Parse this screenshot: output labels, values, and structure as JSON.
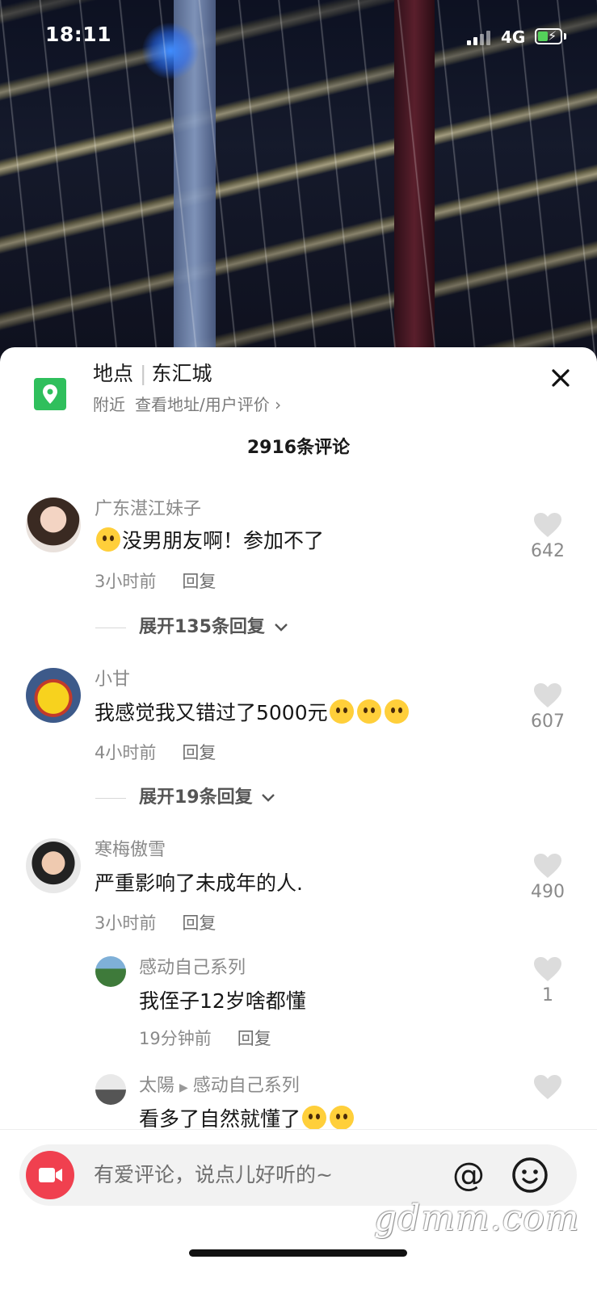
{
  "status_bar": {
    "time": "18:11",
    "network": "4G"
  },
  "location": {
    "label": "地点",
    "name": "东汇城",
    "sub_nearby": "附近",
    "sub_link": "查看地址/用户评价",
    "sub_chevron": "›"
  },
  "close_label": "✕",
  "comment_count": "2916条评论",
  "comments": [
    {
      "name": "广东湛江妹子",
      "text": "没男朋友啊！参加不了",
      "time": "3小时前",
      "reply": "回复",
      "likes": "642",
      "expand": "展开135条回复",
      "emoji": "laughing-tears-emoji"
    },
    {
      "name": "小甘",
      "text": "我感觉我又错过了5000元",
      "time": "4小时前",
      "reply": "回复",
      "likes": "607",
      "expand": "展开19条回复",
      "emoji": "pleading-face-emoji"
    },
    {
      "name": "寒梅傲雪",
      "text": "严重影响了未成年的人.",
      "time": "3小时前",
      "reply": "回复",
      "likes": "490"
    }
  ],
  "replies": [
    {
      "name": "感动自己系列",
      "text": "我侄子12岁啥都懂",
      "time": "19分钟前",
      "reply": "回复",
      "likes": "1"
    },
    {
      "name": "太陽",
      "reply_to": "感动自己系列",
      "text": "看多了自然就懂了",
      "emoji": "grinning-emoji"
    }
  ],
  "input": {
    "placeholder": "有爱评论，说点儿好听的~",
    "at_symbol": "@"
  },
  "watermark": "gdmm.com",
  "colors": {
    "sheet_bg": "#ffffff",
    "location_icon": "#2fbf5c",
    "camera_button": "#f0404f",
    "secondary_text": "#8a8a8a"
  }
}
